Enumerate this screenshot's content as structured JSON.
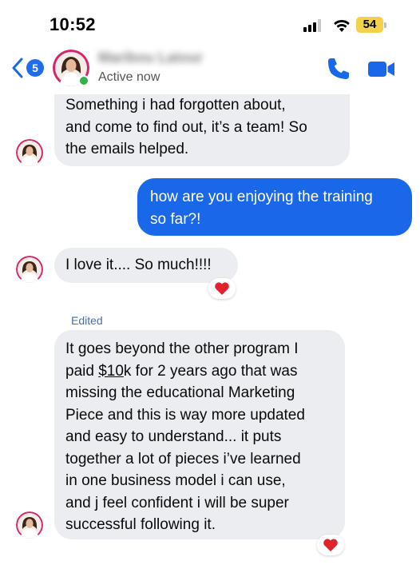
{
  "status_bar": {
    "time": "10:52",
    "battery": "54"
  },
  "header": {
    "back_badge": "5",
    "contact_name": "Maribou Latour",
    "status": "Active now",
    "call_icon": "phone-icon",
    "video_icon": "video-camera-icon"
  },
  "messages": [
    {
      "direction": "incoming",
      "lines": [
        "Something i had forgotten about,",
        "and come to find out, it’s a team! So",
        "the emails helped."
      ]
    },
    {
      "direction": "outgoing",
      "lines": [
        "how are you enjoying the training",
        "so far?!"
      ]
    },
    {
      "direction": "incoming",
      "lines": [
        "I love it.... So much!!!!"
      ],
      "reaction": "heart"
    },
    {
      "direction": "incoming",
      "edited_label": "Edited",
      "lines": [
        {
          "pre": "It goes beyond the other program I",
          "money": "",
          "post": ""
        },
        {
          "pre": "paid ",
          "money": "$10",
          "post": "k for 2 years ago that was"
        },
        {
          "pre": "missing the educational Marketing",
          "money": "",
          "post": ""
        },
        {
          "pre": "Piece and this is way more updated",
          "money": "",
          "post": ""
        },
        {
          "pre": "and easy to understand... it puts",
          "money": "",
          "post": ""
        },
        {
          "pre": "together a lot of pieces i’ve learned",
          "money": "",
          "post": ""
        },
        {
          "pre": "in one business model i can use,",
          "money": "",
          "post": ""
        },
        {
          "pre": "and j feel confident i will be super",
          "money": "",
          "post": ""
        },
        {
          "pre": "successful following it.",
          "money": "",
          "post": ""
        }
      ],
      "reaction": "heart"
    }
  ],
  "colors": {
    "accent": "#1a68ea",
    "incoming_bubble": "#ebedf1",
    "online": "#31b34a",
    "battery": "#f2d24c",
    "heart": "#e0242e"
  }
}
